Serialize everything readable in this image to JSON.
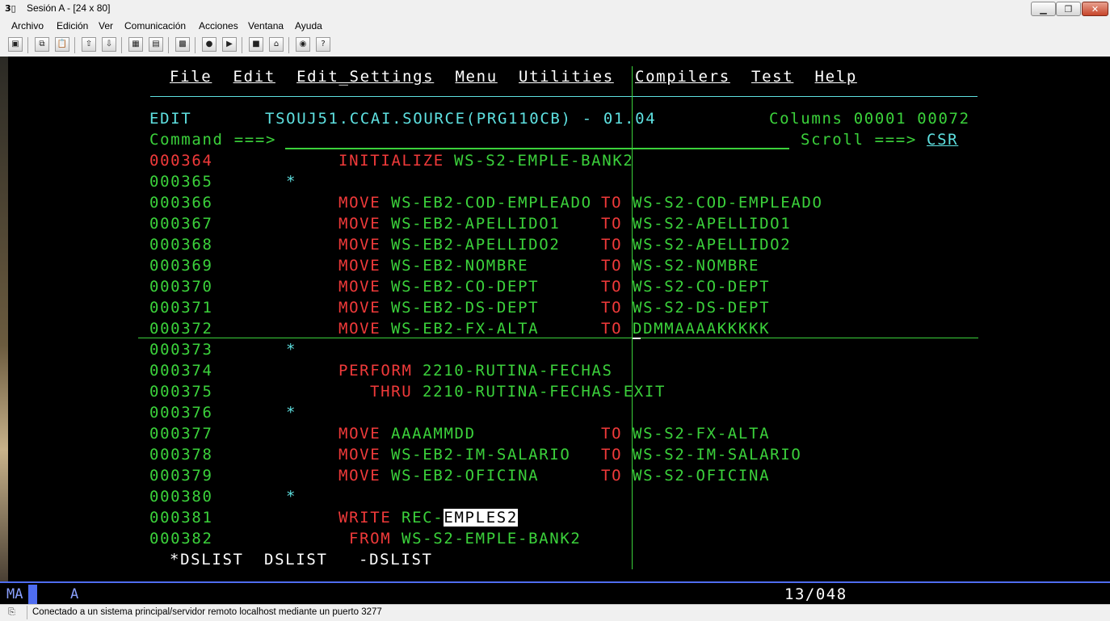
{
  "window": {
    "title": "Sesión A - [24 x 80]",
    "app_icon": "3270-emulator-icon",
    "controls": {
      "minimize": "minimize-icon",
      "maximize": "maximize-icon",
      "close": "close-icon"
    }
  },
  "menubar": {
    "items": [
      "Archivo",
      "Edición",
      "Ver",
      "Comunicación",
      "Acciones",
      "Ventana",
      "Ayuda"
    ]
  },
  "toolbar": {
    "icons": [
      "print-screen-icon",
      "copy-icon",
      "paste-icon",
      "send-icon",
      "receive-icon",
      "display-icon",
      "keypad-icon",
      "macro-icon",
      "record-icon",
      "play-icon",
      "stop-icon",
      "host-icon",
      "connect-icon",
      "help-icon"
    ]
  },
  "ispf": {
    "action_bar": [
      "File",
      "Edit",
      "Edit_Settings",
      "Menu",
      "Utilities",
      "Compilers",
      "Test",
      "Help"
    ],
    "header": {
      "mode": "EDIT",
      "dataset": "TSOUJ51.CCAI.SOURCE(PRG110CB) - 01.04",
      "columns_label": "Columns",
      "col_from": "00001",
      "col_to": "00072"
    },
    "command": {
      "label": "Command ===>",
      "value": "",
      "scroll_label": "Scroll ===>",
      "scroll_value": "CSR"
    },
    "lines": [
      {
        "num": "000364",
        "kw": "INITIALIZE",
        "src": "WS-S2-EMPLE-BANK2",
        "to": "",
        "dst": ""
      },
      {
        "num": "000365",
        "comment": "*"
      },
      {
        "num": "000366",
        "kw": "MOVE",
        "src": "WS-EB2-COD-EMPLEADO",
        "to": "TO",
        "dst": "WS-S2-COD-EMPLEADO"
      },
      {
        "num": "000367",
        "kw": "MOVE",
        "src": "WS-EB2-APELLIDO1",
        "to": "TO",
        "dst": "WS-S2-APELLIDO1"
      },
      {
        "num": "000368",
        "kw": "MOVE",
        "src": "WS-EB2-APELLIDO2",
        "to": "TO",
        "dst": "WS-S2-APELLIDO2"
      },
      {
        "num": "000369",
        "kw": "MOVE",
        "src": "WS-EB2-NOMBRE",
        "to": "TO",
        "dst": "WS-S2-NOMBRE"
      },
      {
        "num": "000370",
        "kw": "MOVE",
        "src": "WS-EB2-CO-DEPT",
        "to": "TO",
        "dst": "WS-S2-CO-DEPT"
      },
      {
        "num": "000371",
        "kw": "MOVE",
        "src": "WS-EB2-DS-DEPT",
        "to": "TO",
        "dst": "WS-S2-DS-DEPT"
      },
      {
        "num": "000372",
        "kw": "MOVE",
        "src": "WS-EB2-FX-ALTA",
        "to": "TO",
        "dst": "DDMMAAAAKKKKK"
      },
      {
        "num": "000373",
        "comment": "*"
      },
      {
        "num": "000374",
        "kw": "PERFORM",
        "src": "2210-RUTINA-FECHAS"
      },
      {
        "num": "000375",
        "kw": "THRU",
        "src": "2210-RUTINA-FECHAS-EXIT"
      },
      {
        "num": "000376",
        "comment": "*"
      },
      {
        "num": "000377",
        "kw": "MOVE",
        "src": "AAAAMMDD",
        "to": "TO",
        "dst": "WS-S2-FX-ALTA"
      },
      {
        "num": "000378",
        "kw": "MOVE",
        "src": "WS-EB2-IM-SALARIO",
        "to": "TO",
        "dst": "WS-S2-IM-SALARIO"
      },
      {
        "num": "000379",
        "kw": "MOVE",
        "src": "WS-EB2-OFICINA",
        "to": "TO",
        "dst": "WS-S2-OFICINA"
      },
      {
        "num": "000380",
        "comment": "*"
      },
      {
        "num": "000381",
        "kw": "WRITE",
        "src_prefix": "REC-",
        "src_selected": "EMPLES2"
      },
      {
        "num": "000382",
        "kw": "FROM",
        "src": "WS-S2-EMPLE-BANK2"
      }
    ],
    "pf_keys": [
      "*DSLIST",
      "DSLIST",
      "-DSLIST"
    ]
  },
  "oia": {
    "mode": "MA",
    "indicator": "A",
    "cursor_pos": "13/048"
  },
  "status": {
    "text": "Conectado a un sistema principal/servidor remoto localhost mediante un puerto 3277"
  },
  "colors": {
    "terminal_bg": "#000000",
    "green": "#3bd13b",
    "red": "#f03a3a",
    "turquoise": "#5ee0e0",
    "white": "#ffffff",
    "oia_blue": "#4f6df0"
  }
}
